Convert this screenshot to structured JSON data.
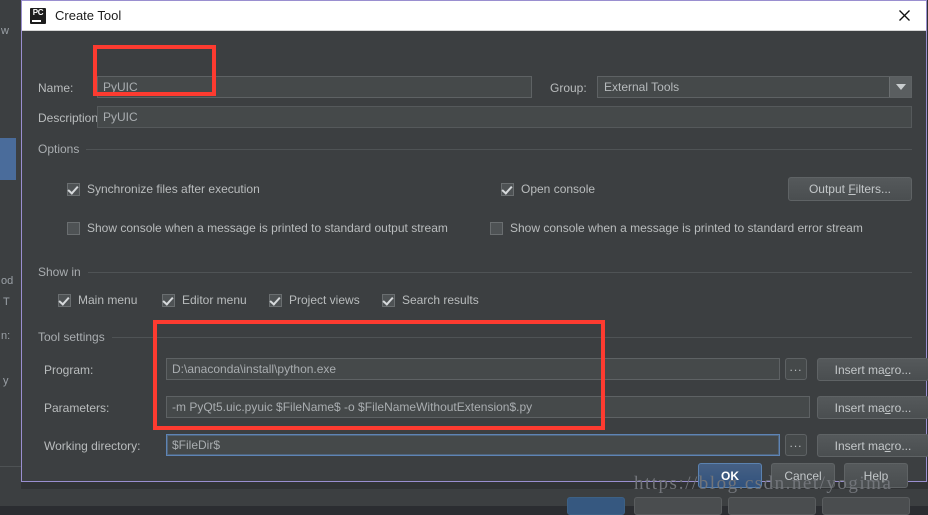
{
  "window": {
    "title": "Create Tool",
    "app_icon": "pycharm-icon",
    "icon_text": "PC",
    "close_icon": "close-icon"
  },
  "fields": {
    "name_label": "Name:",
    "name_value": "PyUIC",
    "description_label": "Description:",
    "description_value": "PyUIC",
    "group_label": "Group:",
    "group_value": "External Tools",
    "group_arrow_icon": "chevron-down-icon"
  },
  "options": {
    "section_title": "Options",
    "checkboxes": [
      {
        "label": "Synchronize files after execution",
        "checked": true
      },
      {
        "label": "Open console",
        "checked": true
      },
      {
        "label": "Show console when a message is printed to standard output stream",
        "checked": false
      },
      {
        "label": "Show console when a message is printed to standard error stream",
        "checked": false
      }
    ],
    "output_filters_label": "Output Filters...",
    "output_filters_underline": "F"
  },
  "show_in": {
    "section_title": "Show in",
    "checkboxes": [
      {
        "label": "Main menu",
        "checked": true
      },
      {
        "label": "Editor menu",
        "checked": true
      },
      {
        "label": "Project views",
        "checked": true
      },
      {
        "label": "Search results",
        "checked": true
      }
    ]
  },
  "tool_settings": {
    "section_title": "Tool settings",
    "rows": [
      {
        "label": "Program:",
        "value": "D:\\anaconda\\install\\python.exe",
        "browse_label": "...",
        "macro_label": "Insert macro...",
        "has_browse": true,
        "focused": false
      },
      {
        "label": "Parameters:",
        "value": "-m PyQt5.uic.pyuic  $FileName$ -o $FileNameWithoutExtension$.py",
        "browse_label": "",
        "macro_label": "Insert macro...",
        "has_browse": false,
        "focused": false
      },
      {
        "label": "Working directory:",
        "value": "$FileDir$",
        "browse_label": "...",
        "macro_label": "Insert macro...",
        "has_browse": true,
        "focused": true
      }
    ],
    "macro_underline": "c"
  },
  "footer": {
    "ok_label": "OK",
    "cancel_label": "Cancel",
    "help_label": "Help"
  },
  "watermark": "https://blog.csdn.net/yogima",
  "background_ghost": {
    "items": [
      "w",
      "od",
      "T",
      "n:",
      "y"
    ]
  },
  "colors": {
    "dialog_bg": "#3c3f41",
    "dialog_border": "#9a8fd0",
    "field_bg": "#45494a",
    "accent_blue": "#365880",
    "annotation_red": "#fd3b30",
    "titlebar_bg": "#ffffff"
  }
}
